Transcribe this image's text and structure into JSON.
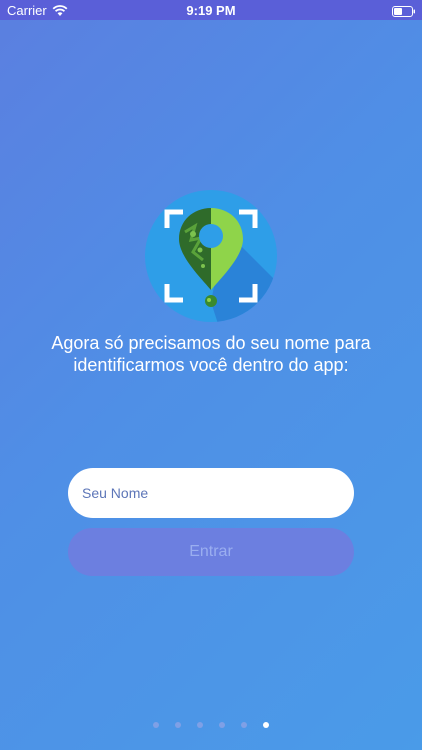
{
  "status_bar": {
    "carrier": "Carrier",
    "time": "9:19 PM"
  },
  "prompt": {
    "line1": "Agora só precisamos do seu nome para",
    "line2": "identificarmos você dentro do app:"
  },
  "name_field": {
    "placeholder": "Seu Nome",
    "value": ""
  },
  "enter_button": {
    "label": "Entrar"
  },
  "pagination": {
    "total": 6,
    "active_index": 5
  },
  "colors": {
    "background_start": "#5b7fe0",
    "background_end": "#4a9be8",
    "status_bar": "#5a5fd8",
    "button_bg": "#6c7fe0",
    "logo_circle": "#2e9ee8",
    "pin_green": "#8fd44a"
  }
}
